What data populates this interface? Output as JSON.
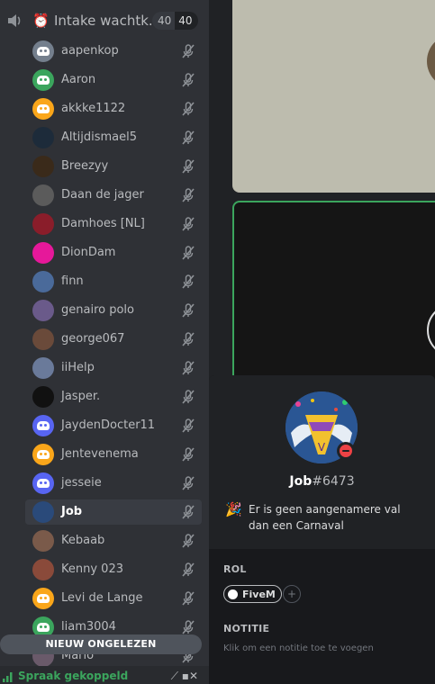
{
  "channel": {
    "name": "Intake wachtk...",
    "user_count": "40",
    "user_limit": "40"
  },
  "users": [
    {
      "name": "aapenkop",
      "avatar": "discord-default-gray"
    },
    {
      "name": "Aaron",
      "avatar": "discord-default-green"
    },
    {
      "name": "akkke1122",
      "avatar": "discord-default-orange"
    },
    {
      "name": "Altijdismael5",
      "avatar": "custom"
    },
    {
      "name": "Breezyy",
      "avatar": "custom"
    },
    {
      "name": "Daan de jager",
      "avatar": "custom"
    },
    {
      "name": "Damhoes [NL]",
      "avatar": "custom"
    },
    {
      "name": "DionDam",
      "avatar": "custom"
    },
    {
      "name": "finn",
      "avatar": "custom"
    },
    {
      "name": "genairo polo",
      "avatar": "custom"
    },
    {
      "name": "george067",
      "avatar": "custom"
    },
    {
      "name": "iiHelp",
      "avatar": "custom"
    },
    {
      "name": "Jasper.",
      "avatar": "custom"
    },
    {
      "name": "JaydenDocter11",
      "avatar": "discord-default-blurple"
    },
    {
      "name": "Jentevenema",
      "avatar": "discord-default-orange"
    },
    {
      "name": "jesseie",
      "avatar": "discord-default-blurple"
    },
    {
      "name": "Job",
      "avatar": "custom",
      "selected": true
    },
    {
      "name": "Kebaab",
      "avatar": "custom"
    },
    {
      "name": "Kenny 023",
      "avatar": "custom"
    },
    {
      "name": "Levi de Lange",
      "avatar": "discord-default-orange"
    },
    {
      "name": "liam3004",
      "avatar": "discord-default-green"
    },
    {
      "name": "Mario",
      "avatar": "custom"
    }
  ],
  "new_unread_label": "NIEUW ONGELEZEN",
  "voice_status": "Spraak gekoppeld",
  "profile": {
    "username": "Job",
    "discriminator": "#6473",
    "custom_status_emoji": "party-popper-icon",
    "custom_status": "Er is geen aangenamere val dan een Carnaval",
    "status": "dnd",
    "roles_label": "ROL",
    "roles": [
      {
        "name": "FiveM",
        "color": "#ffffff"
      }
    ],
    "add_role": "+",
    "note_label": "NOTITIE",
    "note_placeholder": "Klik om een notitie toe te voegen"
  },
  "colors": {
    "sidebar": "#2f3136",
    "popout": "#18191c",
    "speaking_border": "#3ba55d",
    "dnd": "#ed4245",
    "voice_connected": "#3ba55d"
  }
}
